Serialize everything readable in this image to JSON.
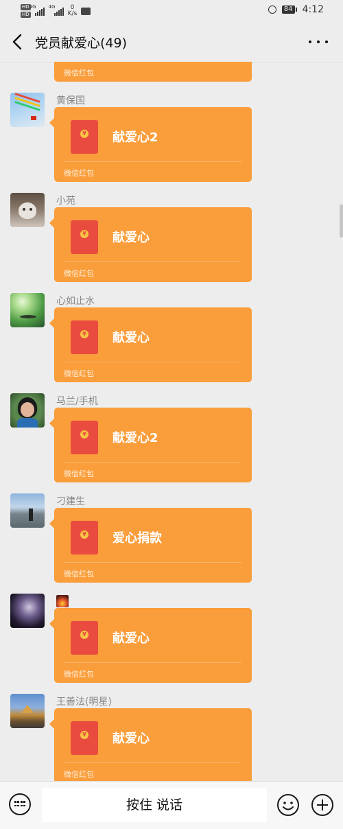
{
  "status_bar": {
    "sim1": "HD",
    "sim2": "HD",
    "net1": "4G",
    "net2": "4G",
    "speed_value": "0",
    "speed_unit": "K/s",
    "battery": "84",
    "time": "4:12"
  },
  "header": {
    "title": "党员献爱心(49)"
  },
  "messages": [
    {
      "sender": "",
      "title": "",
      "label": "微信红包"
    },
    {
      "sender": "黄保国",
      "title": "献爱心2",
      "label": "微信红包"
    },
    {
      "sender": "小苑",
      "title": "献爱心",
      "label": "微信红包"
    },
    {
      "sender": "心如止水",
      "title": "献爱心",
      "label": "微信红包"
    },
    {
      "sender": "马兰/手机",
      "title": "献爱心2",
      "label": "微信红包"
    },
    {
      "sender": "刁建生",
      "title": "爱心捐款",
      "label": "微信红包"
    },
    {
      "sender": "",
      "title": "献爱心",
      "label": "微信红包"
    },
    {
      "sender": "王善法(明星)",
      "title": "献爱心",
      "label": "微信红包"
    }
  ],
  "red_packet_coin": "¥",
  "bottom_bar": {
    "hold_to_talk": "按住 说话"
  },
  "colors": {
    "red_packet": "#fa9d3b",
    "envelope": "#e94b3f",
    "background": "#ededed"
  },
  "icons": [
    "back-arrow-icon",
    "more-icon",
    "keyboard-icon",
    "emoji-icon",
    "plus-icon",
    "alarm-icon",
    "battery-icon"
  ]
}
